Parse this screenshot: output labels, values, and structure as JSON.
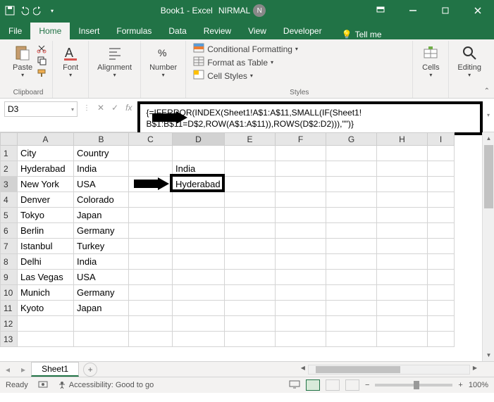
{
  "title": {
    "app_doc": "Book1 - Excel",
    "user": "NIRMAL",
    "avatar_initial": "N"
  },
  "tabs": {
    "file": "File",
    "home": "Home",
    "insert": "Insert",
    "formulas": "Formulas",
    "data": "Data",
    "review": "Review",
    "view": "View",
    "developer": "Developer",
    "tellme": "Tell me"
  },
  "ribbon": {
    "clipboard": {
      "paste": "Paste",
      "label": "Clipboard"
    },
    "font": {
      "btn": "Font"
    },
    "alignment": {
      "btn": "Alignment"
    },
    "number": {
      "btn": "Number"
    },
    "styles": {
      "cond_fmt": "Conditional Formatting",
      "as_table": "Format as Table",
      "cell_styles": "Cell Styles",
      "label": "Styles"
    },
    "cells": {
      "btn": "Cells"
    },
    "editing": {
      "btn": "Editing"
    }
  },
  "formula_bar": {
    "name_box": "D3",
    "formula_line1": "{=IFERROR(INDEX(Sheet1!A$1:A$11,SMALL(IF(Sheet1!",
    "formula_line2": "B$1:B$11=D$2,ROW(A$1:A$11)),ROWS(D$2:D2))),\"\")}"
  },
  "columns": [
    "A",
    "B",
    "C",
    "D",
    "E",
    "F",
    "G",
    "H",
    "I"
  ],
  "rows": [
    "1",
    "2",
    "3",
    "4",
    "5",
    "6",
    "7",
    "8",
    "9",
    "10",
    "11",
    "12",
    "13"
  ],
  "cells": {
    "A1": "City",
    "B1": "Country",
    "A2": "Hyderabad",
    "B2": "India",
    "D2": "India",
    "A3": "New York",
    "B3": "USA",
    "D3": "Hyderabad",
    "A4": "Denver",
    "B4": "Colorado",
    "A5": "Tokyo",
    "B5": "Japan",
    "A6": "Berlin",
    "B6": "Germany",
    "A7": "Istanbul",
    "B7": "Turkey",
    "A8": "Delhi",
    "B8": "India",
    "A9": "Las Vegas",
    "B9": "USA",
    "A10": "Munich",
    "B10": "Germany",
    "A11": "Kyoto",
    "B11": "Japan"
  },
  "sheet": {
    "name": "Sheet1"
  },
  "status": {
    "ready": "Ready",
    "accessibility": "Accessibility: Good to go",
    "zoom": "100%"
  }
}
